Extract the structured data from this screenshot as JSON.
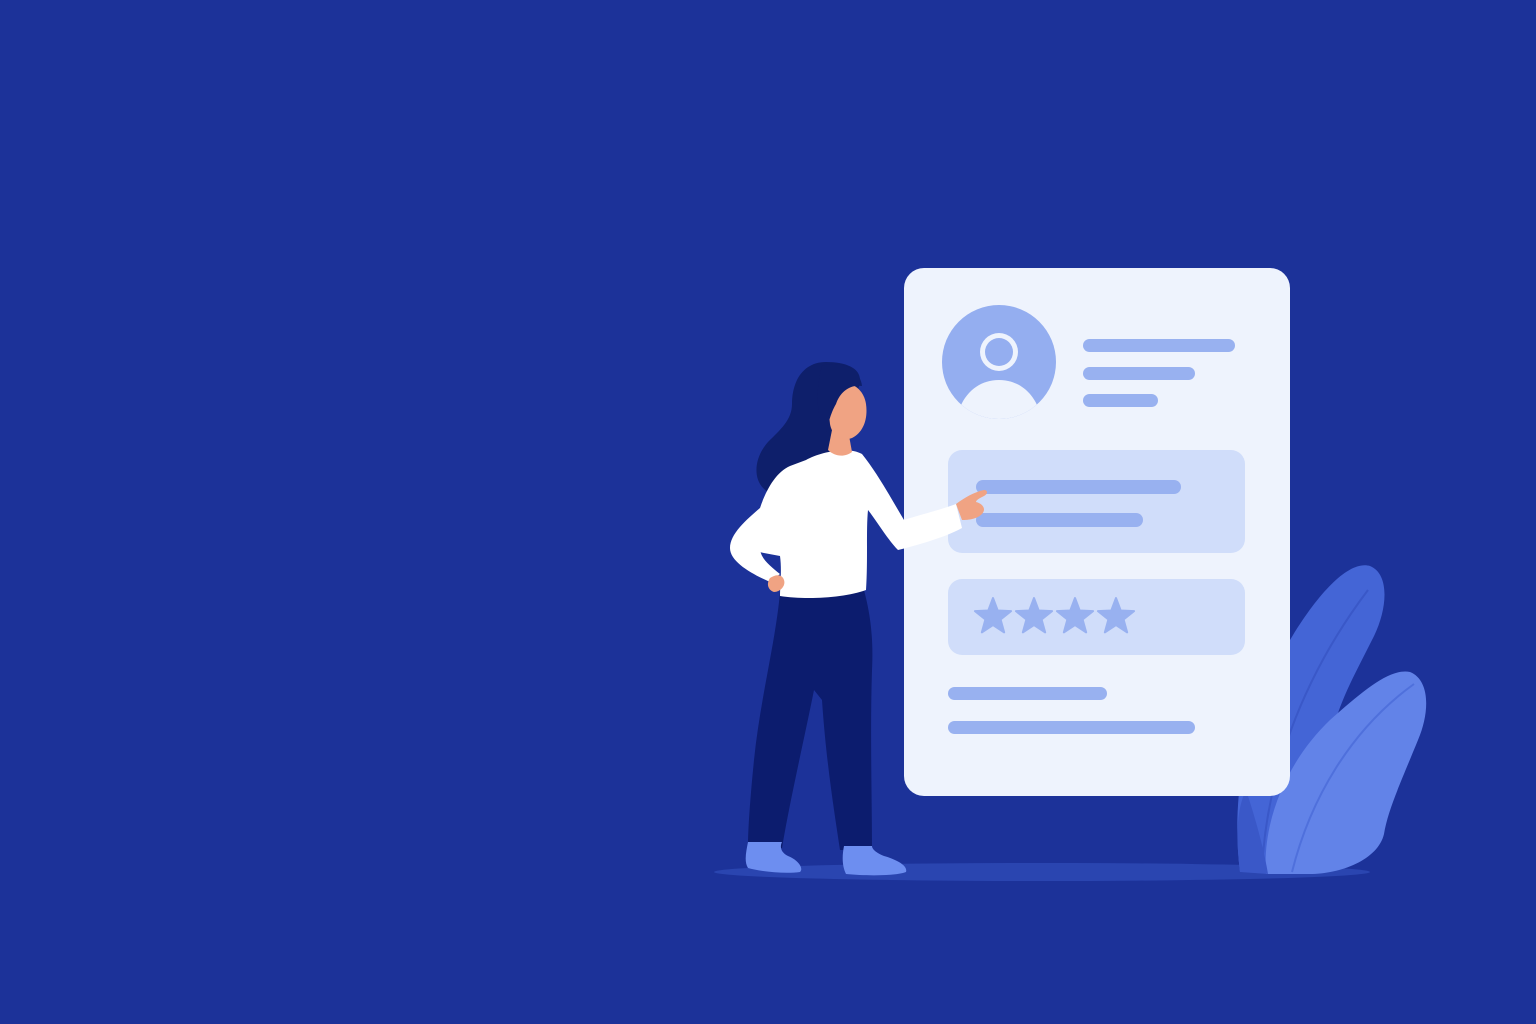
{
  "colors": {
    "background": "#1c3299",
    "card": "#eef3fd",
    "panel": "#d0ddfa",
    "placeholder_line": "#98b1f0",
    "avatar": "#94aef0",
    "hair": "#0e1f6b",
    "skin": "#f0a383",
    "shirt": "#ffffff",
    "pants": "#0c1c6e",
    "shoes": "#6d8ef0",
    "plant_dark": "#4465d6",
    "plant_light": "#6283e8",
    "floor_shadow": "#2a45b0"
  },
  "illustration": {
    "rating": {
      "filled_stars": 4
    },
    "icons": [
      "avatar-icon",
      "star-icon"
    ]
  }
}
